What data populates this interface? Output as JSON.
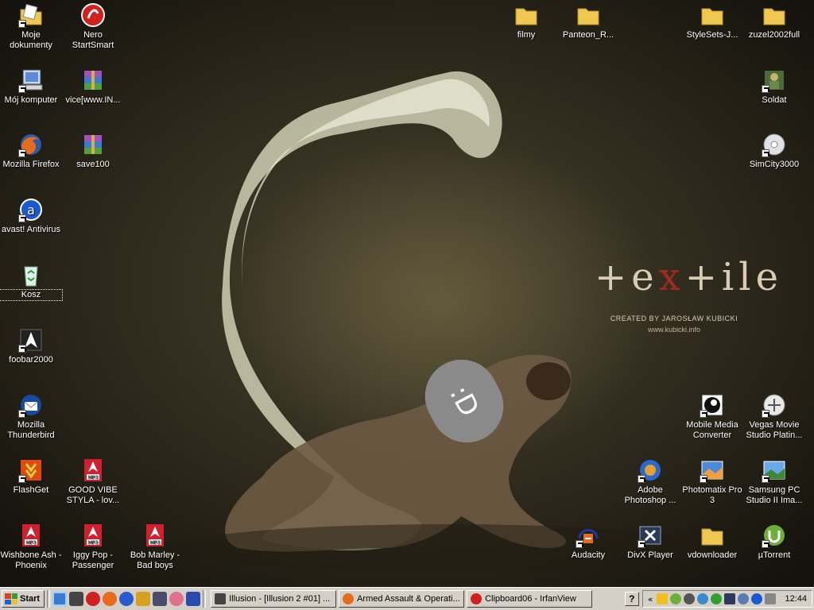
{
  "wallpaper": {
    "brand_logo_a": "+e",
    "brand_logo_x": "x",
    "brand_logo_b": "+ile",
    "credit": "CREATED BY JAROSŁAW KUBICKI",
    "url": "www.kubicki.info",
    "censor_text": ":D"
  },
  "icons": {
    "moje_dokumenty": "Moje dokumenty",
    "nero": "Nero StartSmart",
    "moj_komputer": "Mój komputer",
    "vice": "vice[www.IN...",
    "firefox": "Mozilla Firefox",
    "save100": "save100",
    "avast": "avast! Antivirus",
    "kosz": "Kosz",
    "foobar": "foobar2000",
    "thunderbird": "Mozilla Thunderbird",
    "flashget": "FlashGet",
    "goodvibe": "GOOD VIBE STYLA - lov...",
    "wishbone": "Wishbone Ash - Phoenix",
    "iggypop": "Iggy Pop - Passenger",
    "bobmarley": "Bob Marley - Bad boys",
    "filmy": "filmy",
    "panteon": "Panteon_R...",
    "stylesets": "StyleSets-J...",
    "zuzel": "zuzel2002full",
    "soldat": "Soldat",
    "simcity": "SimCity3000",
    "mobilemedia": "Mobile Media Converter",
    "vegas": "Vegas Movie Studio Platin...",
    "photoshop": "Adobe Photoshop ...",
    "photomatix": "Photomatix Pro 3",
    "samsung": "Samsung PC Studio II Ima...",
    "audacity": "Audacity",
    "divx": "DivX Player",
    "vdownloader": "vdownloader",
    "utorrent": "µTorrent"
  },
  "taskbar": {
    "start_label": "Start",
    "tasks": [
      "Illusion - [Illusion 2 #01] ...",
      "Armed Assault & Operati...",
      "Clipboard06 - IrfanView"
    ],
    "help_label": "?",
    "tray_chevron": "«",
    "clock": "12:44"
  },
  "colors": {
    "taskbar_bg": "#d4d0c8",
    "brand_x": "#a02a1c",
    "folder": "#f0c850"
  }
}
